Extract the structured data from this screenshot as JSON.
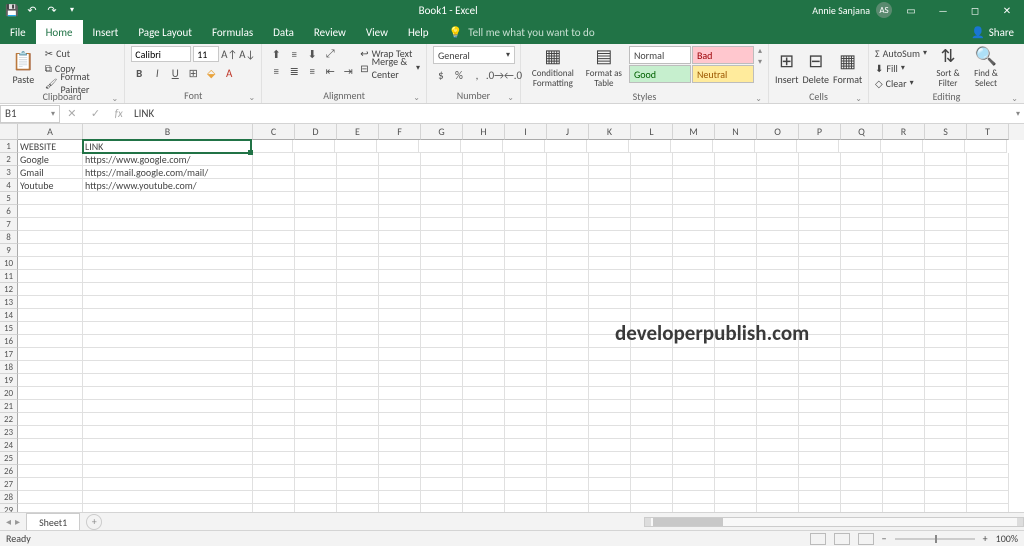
{
  "titlebar": {
    "title": "Book1 - Excel",
    "user": "Annie Sanjana",
    "avatar": "AS"
  },
  "menutabs": {
    "file": "File",
    "home": "Home",
    "insert": "Insert",
    "pagelayout": "Page Layout",
    "formulas": "Formulas",
    "data": "Data",
    "review": "Review",
    "view": "View",
    "help": "Help",
    "tellme": "Tell me what you want to do",
    "share": "Share"
  },
  "ribbon": {
    "clipboard": {
      "label": "Clipboard",
      "paste": "Paste",
      "cut": "Cut",
      "copy": "Copy",
      "painter": "Format Painter"
    },
    "font": {
      "label": "Font",
      "name": "Calibri",
      "size": "11"
    },
    "alignment": {
      "label": "Alignment",
      "wrap": "Wrap Text",
      "merge": "Merge & Center"
    },
    "number": {
      "label": "Number",
      "format": "General"
    },
    "styles": {
      "label": "Styles",
      "cond": "Conditional Formatting",
      "fmttable": "Format as Table",
      "normal": "Normal",
      "bad": "Bad",
      "good": "Good",
      "neutral": "Neutral"
    },
    "cells": {
      "label": "Cells",
      "insert": "Insert",
      "delete": "Delete",
      "format": "Format"
    },
    "editing": {
      "label": "Editing",
      "autosum": "AutoSum",
      "fill": "Fill",
      "clear": "Clear",
      "sort": "Sort & Filter",
      "find": "Find & Select"
    }
  },
  "formulabar": {
    "namebox": "B1",
    "formula": "LINK"
  },
  "columns": [
    "A",
    "B",
    "C",
    "D",
    "E",
    "F",
    "G",
    "H",
    "I",
    "J",
    "K",
    "L",
    "M",
    "N",
    "O",
    "P",
    "Q",
    "R",
    "S",
    "T"
  ],
  "colwidths": {
    "A": 65,
    "B": 170,
    "default": 42
  },
  "rowcount": 29,
  "cells": {
    "A1": "WEBSITE",
    "B1": "LINK",
    "A2": "Google",
    "B2": "https://www.google.com/",
    "A3": "Gmail",
    "B3": "https://mail.google.com/mail/",
    "A4": "Youtube",
    "B4": "https://www.youtube.com/"
  },
  "selected": "B1",
  "sheets": {
    "active": "Sheet1"
  },
  "status": {
    "ready": "Ready",
    "zoom": "100%"
  },
  "watermark": "developerpublish.com"
}
